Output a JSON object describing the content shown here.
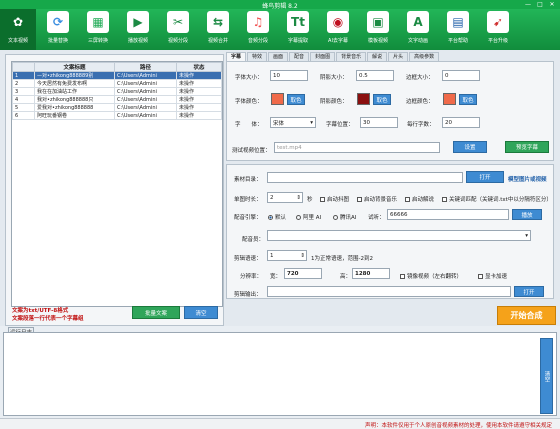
{
  "window": {
    "title": "蜂鸟剪辑 8.2",
    "min": "—",
    "max": "□",
    "close": "✕"
  },
  "toolbar": [
    {
      "label": "文本视频",
      "icon": "text-video-icon",
      "color": "#ffffff"
    },
    {
      "label": "批量替换",
      "icon": "replace-icon",
      "color": "#3d8fe0"
    },
    {
      "label": "三屏转换",
      "icon": "film-icon",
      "color": "#1faa55"
    },
    {
      "label": "播放视频",
      "icon": "play-icon",
      "color": "#1b8a43"
    },
    {
      "label": "视频分段",
      "icon": "cut-icon",
      "color": "#1b8a43"
    },
    {
      "label": "视频合并",
      "icon": "merge-icon",
      "color": "#1b8a43"
    },
    {
      "label": "音频分段",
      "icon": "music-icon",
      "color": "#f05050"
    },
    {
      "label": "字幕提取",
      "icon": "tt-icon",
      "color": "#1b8a43"
    },
    {
      "label": "AI去字幕",
      "icon": "target-icon",
      "color": "#c01020"
    },
    {
      "label": "模板视频",
      "icon": "template-icon",
      "color": "#1b8a43"
    },
    {
      "label": "文字动画",
      "icon": "text-anim-icon",
      "color": "#1b8a43"
    },
    {
      "label": "平台帮助",
      "icon": "book-icon",
      "color": "#1f5fa8"
    },
    {
      "label": "平台升级",
      "icon": "rocket-icon",
      "color": "#d03030"
    }
  ],
  "table": {
    "headers": [
      "",
      "文案标题",
      "路径",
      "状态"
    ],
    "rows": [
      {
        "num": "1",
        "title": "—对•zhikong888889别",
        "path": "C:\\Users\\Admini",
        "status": "未操作"
      },
      {
        "num": "2",
        "title": "今天居然有免费发布啊",
        "path": "C:\\Users\\Admini",
        "status": "未操作"
      },
      {
        "num": "3",
        "title": "我在在加油站工作",
        "path": "C:\\Users\\Admini",
        "status": "未操作"
      },
      {
        "num": "4",
        "title": "我对•zhikong888888只",
        "path": "C:\\Users\\Admini",
        "status": "未操作"
      },
      {
        "num": "5",
        "title": "爱我对•zhikong888888",
        "path": "C:\\Users\\Admini",
        "status": "未操作"
      },
      {
        "num": "6",
        "title": "阿旺玩番钢卷",
        "path": "C:\\Users\\Admini",
        "status": "未操作"
      }
    ]
  },
  "left_notes": [
    "文案为txt/UTF-8格式",
    "文案段落一行代表一个字幕组"
  ],
  "left_buttons": {
    "import": "批量文案",
    "clear": "清空"
  },
  "tabs": [
    "字幕",
    "特效",
    "画面",
    "配音",
    "封面图",
    "背景音乐",
    "解说",
    "片头",
    "高级参数"
  ],
  "subtitle": {
    "font_size_label": "字体大小：",
    "font_size": "10",
    "shadow_size_label": "阴影大小：",
    "shadow_size": "0.5",
    "border_size_label": "边框大小：",
    "border_size": "0",
    "font_color_label": "字体颜色：",
    "font_color": "#f06a4a",
    "shadow_color_label": "阴影颜色：",
    "shadow_color": "#8a0f0f",
    "border_color_label": "边框颜色：",
    "border_color": "#f06a4a",
    "pick": "取色",
    "font_label": "字　　体：",
    "font": "宋体",
    "pos_label": "字幕位置：",
    "pos": "30",
    "per_line_label": "每行字数：",
    "per_line": "20",
    "test_label": "测试视频位置：",
    "test_placeholder": "test.mp4",
    "set_btn": "设置",
    "preview_btn": "预览字幕"
  },
  "lower": {
    "material_label": "素材目录：",
    "open_btn": "打开",
    "template_link": "模型图片或视频",
    "duration_label": "单图时长：",
    "duration": "2",
    "sec": "秒",
    "opt1": "启动抖图",
    "opt2": "启动背景音乐",
    "opt3": "启动解说",
    "opt4": "关键词匹配（关键词.txt中以分隔符区分）",
    "engine_label": "配音引擎：",
    "engine_default": "默认",
    "engine_ali": "阿里 AI",
    "engine_tx": "腾讯AI",
    "test_label": "试听：",
    "test_text": "66666",
    "play_btn": "播放",
    "voice_label": "配音员：",
    "speed_label": "剪辑语速：",
    "speed": "1",
    "speed_hint": "1为正常语速，范围-2到2",
    "res_label": "分辨率：",
    "w_label": "宽：",
    "width": "720",
    "h_label": "高：",
    "height": "1280",
    "mirror": "镜像视频（左右翻转）",
    "fill": "显卡加速",
    "output_label": "剪辑输出：",
    "output_btn": "打开"
  },
  "start_btn": "开始合成",
  "log": {
    "title": "运行日志",
    "clear": "清空"
  },
  "status": "声明：本软件仅用于个人原创音视频素材的处理，使用本软件请遵守相关规定"
}
